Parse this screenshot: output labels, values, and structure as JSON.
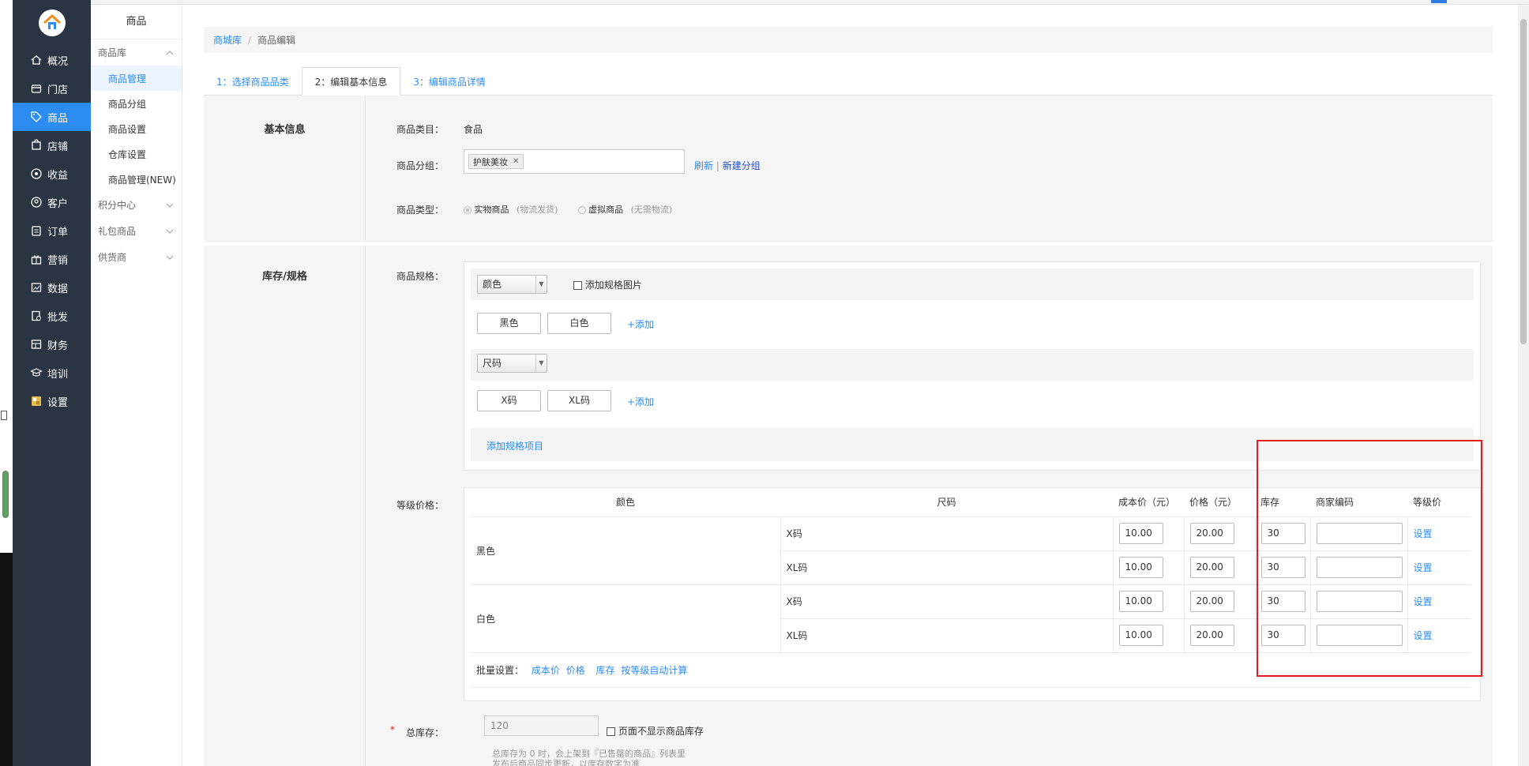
{
  "nav": {
    "items": [
      {
        "label": "概况",
        "icon": "home-icon"
      },
      {
        "label": "门店",
        "icon": "store-icon"
      },
      {
        "label": "商品",
        "icon": "tag-icon",
        "active": true
      },
      {
        "label": "店铺",
        "icon": "shop-bag-icon"
      },
      {
        "label": "收益",
        "icon": "coin-icon"
      },
      {
        "label": "客户",
        "icon": "user-icon"
      },
      {
        "label": "订单",
        "icon": "order-icon"
      },
      {
        "label": "营销",
        "icon": "gift-icon"
      },
      {
        "label": "数据",
        "icon": "chart-icon"
      },
      {
        "label": "批发",
        "icon": "wholesale-icon"
      },
      {
        "label": "财务",
        "icon": "finance-icon"
      },
      {
        "label": "培训",
        "icon": "training-icon"
      },
      {
        "label": "设置",
        "icon": "settings-icon"
      }
    ]
  },
  "subnav": {
    "title": "商品",
    "groups": [
      {
        "label": "商品库",
        "expanded": true,
        "items": [
          "商品管理",
          "商品分组",
          "商品设置",
          "仓库设置",
          "商品管理(NEW)"
        ]
      },
      {
        "label": "积分中心"
      },
      {
        "label": "礼包商品"
      },
      {
        "label": "供货商"
      }
    ]
  },
  "breadcrumb": {
    "root": "商城库",
    "sep": "/",
    "current": "商品编辑"
  },
  "tabs": [
    "1：选择商品品类",
    "2：编辑基本信息",
    "3：编辑商品详情"
  ],
  "basic": {
    "section_title": "基本信息",
    "category_label": "商品类目：",
    "category_value": "食品",
    "group_label": "商品分组：",
    "group_tag": "护肤美妆",
    "refresh": "刷新",
    "divider": "|",
    "new_group": "新建分组",
    "type_label": "商品类型：",
    "type_physical": "实物商品",
    "type_physical_note": "(物流发货)",
    "type_virtual": "虚拟商品",
    "type_virtual_note": "(无需物流)"
  },
  "spec": {
    "section_title": "库存/规格",
    "spec_label": "商品规格：",
    "spec1_name": "颜色",
    "add_image": "添加规格图片",
    "spec1_values": [
      "黑色",
      "白色"
    ],
    "add": "+添加",
    "spec2_name": "尺码",
    "spec2_values": [
      "X码",
      "XL码"
    ],
    "add_spec_item": "添加规格项目",
    "price_label": "等级价格：",
    "headers": [
      "颜色",
      "尺码",
      "成本价（元）",
      "价格（元）",
      "库存",
      "商家编码",
      "等级价"
    ],
    "rows": [
      {
        "color": "黑色",
        "size": "X码",
        "cost": "10.00",
        "price": "20.00",
        "stock": "30",
        "code": "",
        "action": "设置"
      },
      {
        "color": "",
        "size": "XL码",
        "cost": "10.00",
        "price": "20.00",
        "stock": "30",
        "code": "",
        "action": "设置"
      },
      {
        "color": "白色",
        "size": "X码",
        "cost": "10.00",
        "price": "20.00",
        "stock": "30",
        "code": "",
        "action": "设置"
      },
      {
        "color": "",
        "size": "XL码",
        "cost": "10.00",
        "price": "20.00",
        "stock": "30",
        "code": "",
        "action": "设置"
      }
    ],
    "batch_label": "批量设置：",
    "batch_links": [
      "成本价",
      "价格",
      "库存",
      "按等级自动计算"
    ],
    "total_stock_star": "*",
    "total_stock_label": "总库存：",
    "total_stock_value": "120",
    "hide_stock": "页面不显示商品库存",
    "hint_line1": "总库存为 0 时，会上架到『已售罄的商品』列表里",
    "hint_line2": "发布后商品同步更新，以库存数字为准"
  },
  "colors": {
    "primary": "#2d8cf0",
    "nav_bg": "#2b3443",
    "highlight_box": "#e02020"
  }
}
